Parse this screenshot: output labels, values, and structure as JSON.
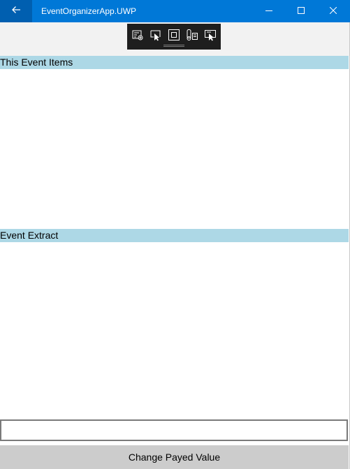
{
  "window": {
    "title": "EventOrganizerApp.UWP",
    "accent_color": "#0078d7",
    "back_button_color": "#005fb0",
    "caption_buttons": [
      "minimize-icon",
      "maximize-icon",
      "close-icon"
    ]
  },
  "debug_toolbar": {
    "icons": [
      "live-visual-tree-icon",
      "select-element-icon",
      "display-layout-adorners-icon",
      "track-focus-icon",
      "preview-selection-icon"
    ]
  },
  "sections": {
    "event_items": {
      "header": "This Event Items",
      "header_color": "#add8e6",
      "items": []
    },
    "event_extract": {
      "header": "Event Extract",
      "header_color": "#add8e6",
      "items": []
    }
  },
  "input": {
    "value": "",
    "placeholder": ""
  },
  "action": {
    "label": "Change Payed Value",
    "background": "#cccccc"
  }
}
